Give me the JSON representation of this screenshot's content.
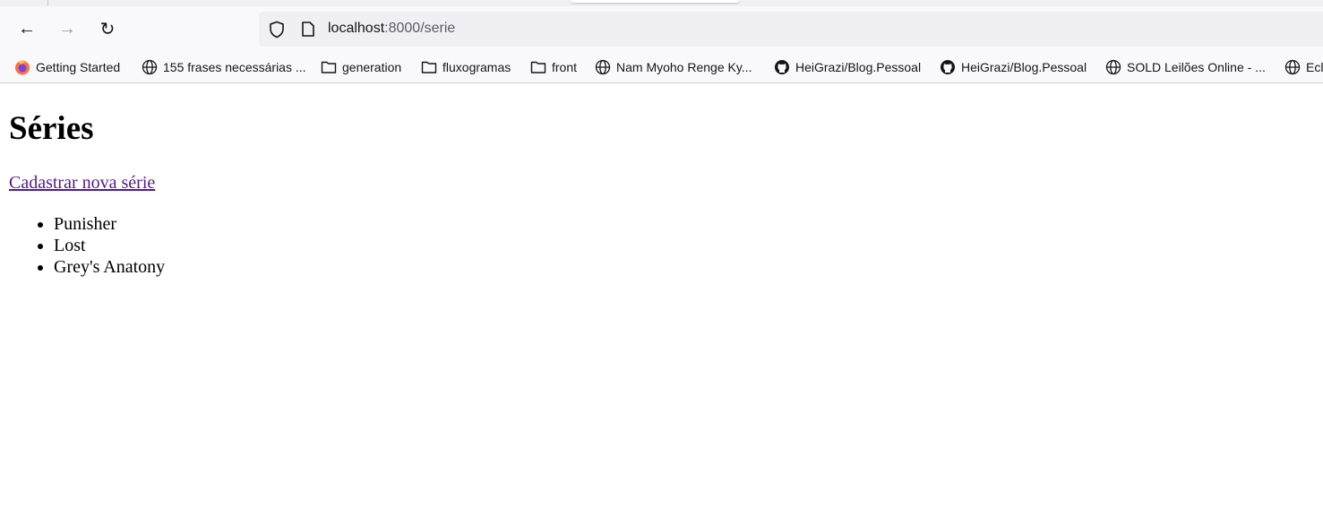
{
  "browser": {
    "url_host": "localhost",
    "url_path": ":8000/serie",
    "bookmarks": [
      {
        "label": "Getting Started",
        "icon": "firefox-icon"
      },
      {
        "label": "155 frases necessárias ...",
        "icon": "globe-icon"
      },
      {
        "label": "generation",
        "icon": "folder-icon"
      },
      {
        "label": "fluxogramas",
        "icon": "folder-icon"
      },
      {
        "label": "front",
        "icon": "folder-icon"
      },
      {
        "label": "Nam Myoho Renge Ky...",
        "icon": "globe-icon"
      },
      {
        "label": "HeiGrazi/Blog.Pessoal",
        "icon": "github-icon"
      },
      {
        "label": "HeiGrazi/Blog.Pessoal",
        "icon": "github-icon"
      },
      {
        "label": "SOLD Leilões Online - ...",
        "icon": "globe-icon"
      },
      {
        "label": "Ecl",
        "icon": "globe-icon"
      }
    ]
  },
  "page": {
    "title": "Séries",
    "new_link": "Cadastrar nova série",
    "series": [
      "Punisher",
      "Lost",
      "Grey's Anatony"
    ]
  }
}
